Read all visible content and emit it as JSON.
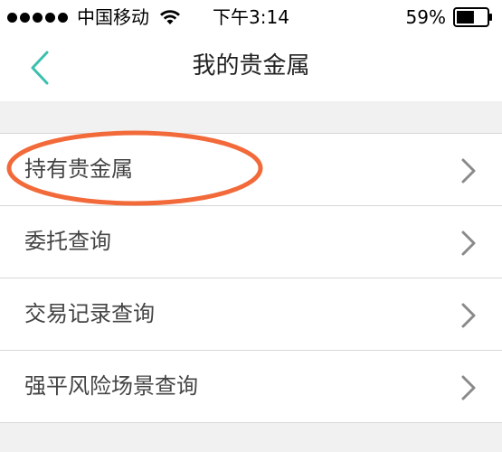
{
  "status_bar": {
    "carrier": "中国移动",
    "time": "下午3:14",
    "battery": "59%",
    "battery_level": 0.59
  },
  "header": {
    "title": "我的贵金属"
  },
  "menu": {
    "items": [
      {
        "label": "持有贵金属"
      },
      {
        "label": "委托查询"
      },
      {
        "label": "交易记录查询"
      },
      {
        "label": "强平风险场景查询"
      }
    ]
  },
  "annotation": {
    "highlighted_item": "持有贵金属",
    "color": "#f26a3a"
  },
  "colors": {
    "accent": "#3bbfae",
    "divider": "#d8d8d8",
    "background": "#f1f1f1"
  }
}
